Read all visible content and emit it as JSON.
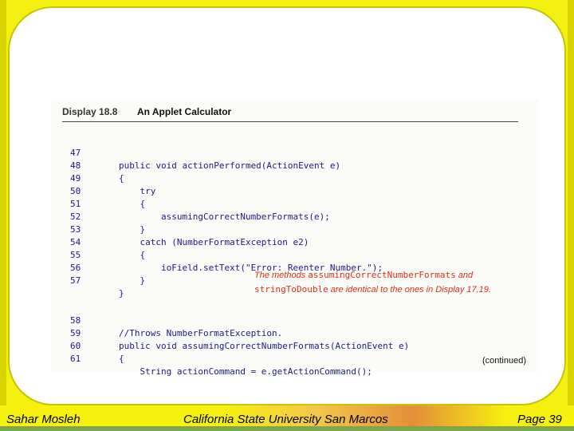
{
  "figure": {
    "number": "Display 18.8",
    "title": "An Applet Calculator",
    "continued": "(continued)"
  },
  "code_lines": [
    {
      "n": "47",
      "text": "public void actionPerformed(ActionEvent e)"
    },
    {
      "n": "48",
      "text": "{"
    },
    {
      "n": "49",
      "text": "    try"
    },
    {
      "n": "50",
      "text": "    {"
    },
    {
      "n": "51",
      "text": "        assumingCorrectNumberFormats(e);"
    },
    {
      "n": "52",
      "text": "    }"
    },
    {
      "n": "53",
      "text": "    catch (NumberFormatException e2)"
    },
    {
      "n": "54",
      "text": "    {"
    },
    {
      "n": "55",
      "text": "        ioField.setText(\"Error: Reenter Number.\");"
    },
    {
      "n": "56",
      "text": "    }"
    },
    {
      "n": "57",
      "text": "}"
    },
    {
      "n": "58",
      "text": "//Throws NumberFormatException."
    },
    {
      "n": "59",
      "text": "public void assumingCorrectNumberFormats(ActionEvent e)"
    },
    {
      "n": "60",
      "text": "{"
    },
    {
      "n": "61",
      "text": "    String actionCommand = e.getActionCommand();"
    }
  ],
  "callout": {
    "part1": "The methods ",
    "code1": "assumingCorrectNumberFormats",
    "part2": " and",
    "code2": "stringToDouble",
    "part3": " are identical to the ones in Display 17.19."
  },
  "footer": {
    "author": "Sahar Mosleh",
    "institution": "California State University San Marcos",
    "page_label": "Page",
    "page_number": "39"
  },
  "colors": {
    "background": "#f4f110",
    "code": "#1a1a8a",
    "callout": "#d9301a"
  }
}
